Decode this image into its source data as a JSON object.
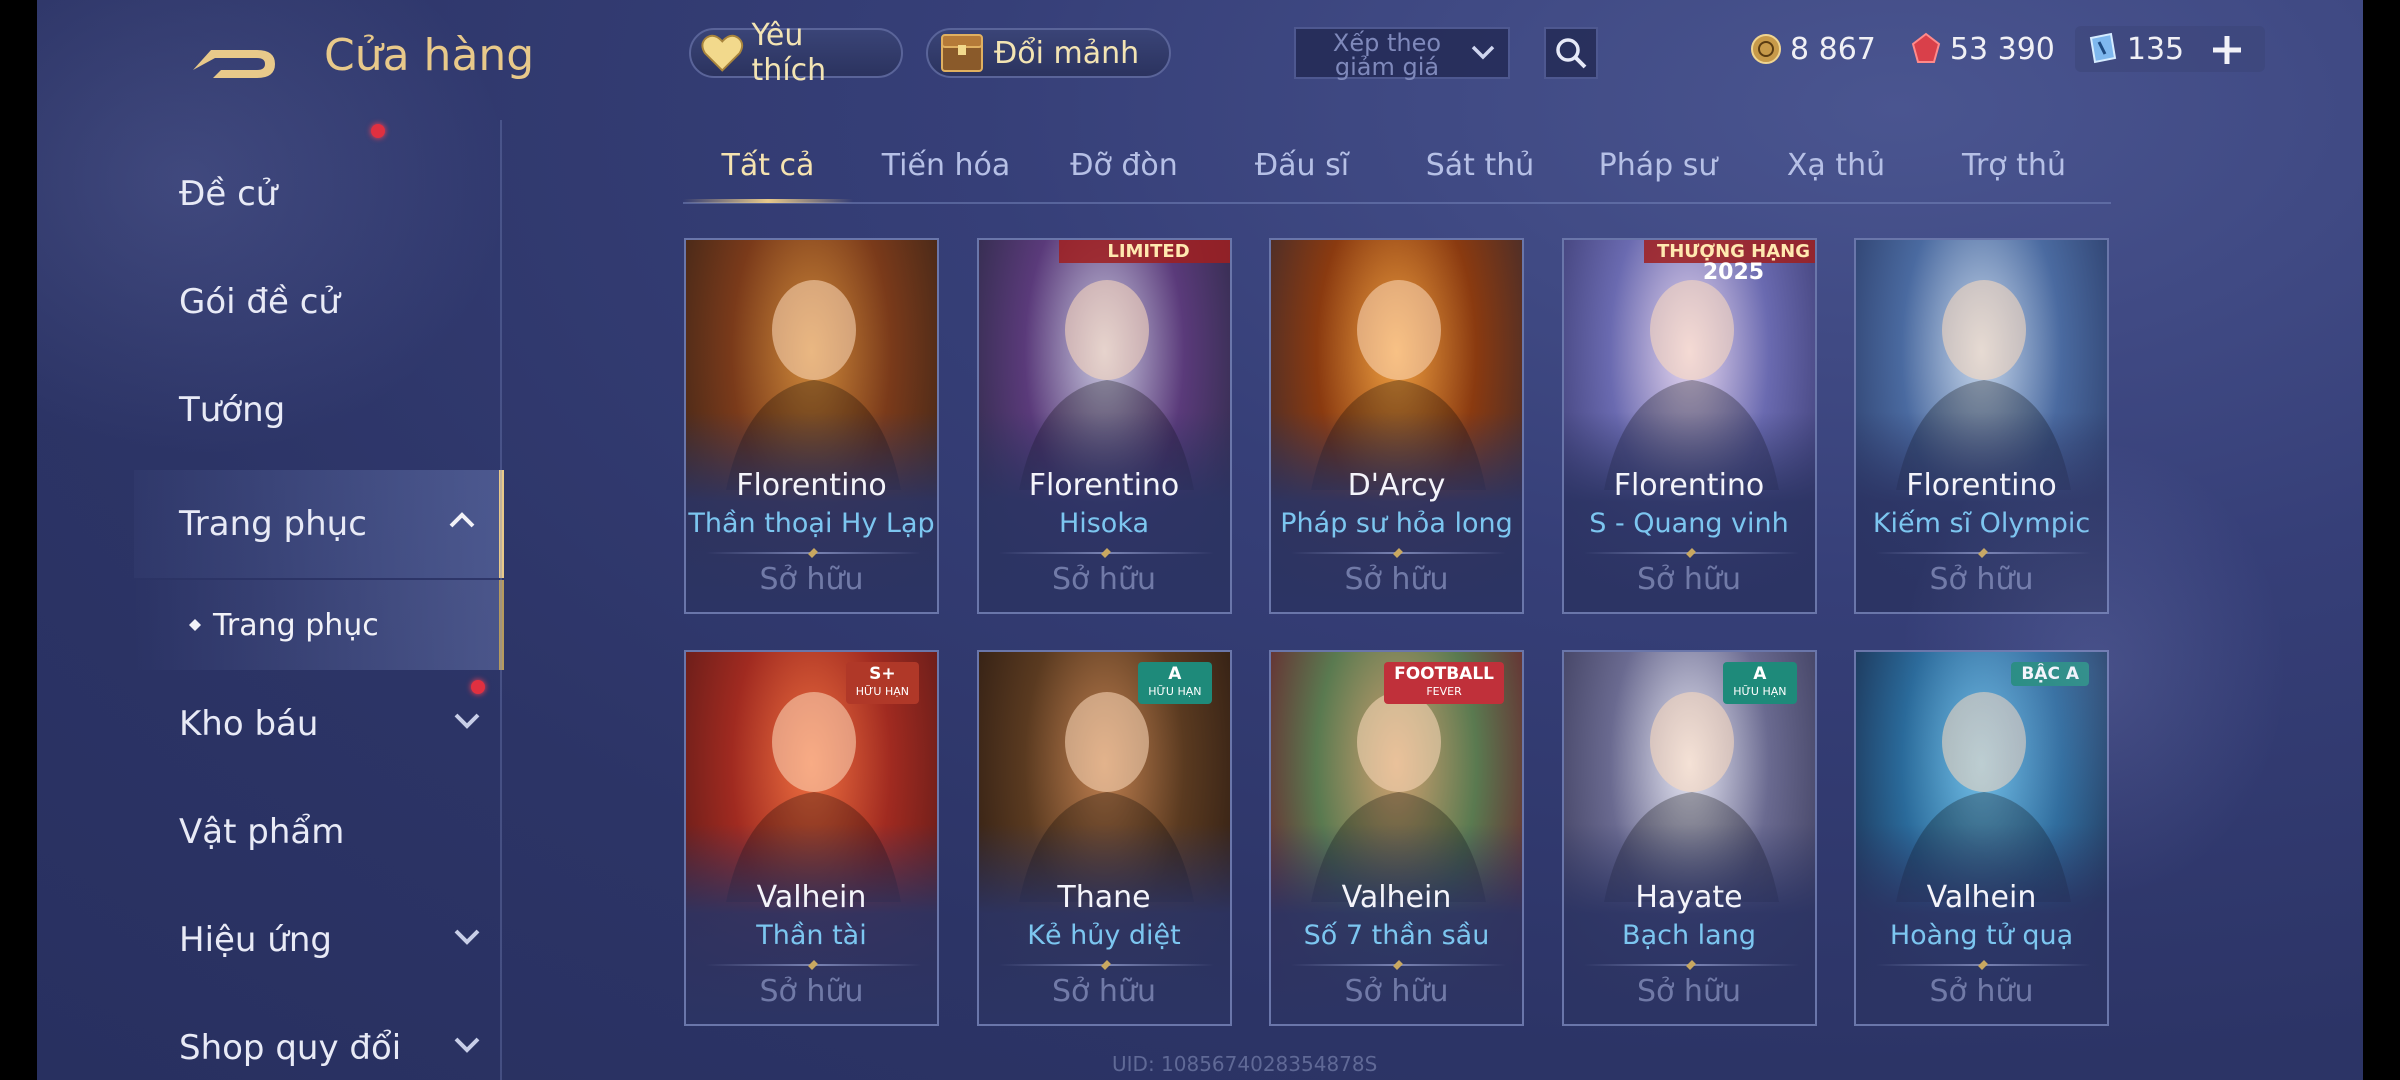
{
  "header": {
    "title": "Cửa hàng",
    "favorites_label": "Yêu thích",
    "shards_label": "Đổi mảnh",
    "sort_label": "Xếp theo giảm giá",
    "currencies": [
      {
        "icon": "gold-coin-icon",
        "value": "8 867"
      },
      {
        "icon": "red-gem-icon",
        "value": "53 390"
      },
      {
        "icon": "blue-voucher-icon",
        "value": "135"
      }
    ]
  },
  "sidebar": {
    "items": [
      {
        "label": "Đề cử"
      },
      {
        "label": "Gói đề cử"
      },
      {
        "label": "Tướng"
      },
      {
        "label": "Trang phục"
      },
      {
        "label": "Kho báu"
      },
      {
        "label": "Vật phẩm"
      },
      {
        "label": "Hiệu ứng"
      },
      {
        "label": "Shop quy đổi"
      }
    ],
    "sub_item": "Trang phục"
  },
  "tabs": [
    "Tất cả",
    "Tiến hóa",
    "Đỡ đòn",
    "Đấu sĩ",
    "Sát thủ",
    "Pháp sư",
    "Xạ thủ",
    "Trợ thủ"
  ],
  "cards": [
    {
      "hero": "Florentino",
      "skin": "Thần thoại Hy Lạp",
      "status": "Sở hữu"
    },
    {
      "hero": "Florentino",
      "skin": "Hisoka",
      "status": "Sở hữu",
      "banner": "LIMITED"
    },
    {
      "hero": "D'Arcy",
      "skin": "Pháp sư hỏa long",
      "status": "Sở hữu"
    },
    {
      "hero": "Florentino",
      "skin": "S - Quang vinh",
      "status": "Sở hữu",
      "banner": "THƯỢNG HẠNG",
      "banner2": "2025"
    },
    {
      "hero": "Florentino",
      "skin": "Kiếm sĩ Olympic",
      "status": "Sở hữu"
    },
    {
      "hero": "Valhein",
      "skin": "Thần tài",
      "status": "Sở hữu",
      "badge": "S+",
      "badge_sub": "HỮU HẠN"
    },
    {
      "hero": "Thane",
      "skin": "Kẻ hủy diệt",
      "status": "Sở hữu",
      "badge": "A",
      "badge_sub": "HỮU HẠN"
    },
    {
      "hero": "Valhein",
      "skin": "Số 7 thần sầu",
      "status": "Sở hữu",
      "badge": "FOOTBALL",
      "badge_sub": "FEVER"
    },
    {
      "hero": "Hayate",
      "skin": "Bạch lang",
      "status": "Sở hữu",
      "badge": "A",
      "badge_sub": "HỮU HẠN"
    },
    {
      "hero": "Valhein",
      "skin": "Hoàng tử quạ",
      "status": "Sở hữu",
      "badge": "BẬC A"
    }
  ],
  "uid_text": "UID: 1085674028354878S",
  "colors": {
    "accent_gold": "#e8c98a",
    "skin_blue": "#7cc6f0",
    "owned_gray": "#717aa7",
    "bg": "#323b72"
  }
}
